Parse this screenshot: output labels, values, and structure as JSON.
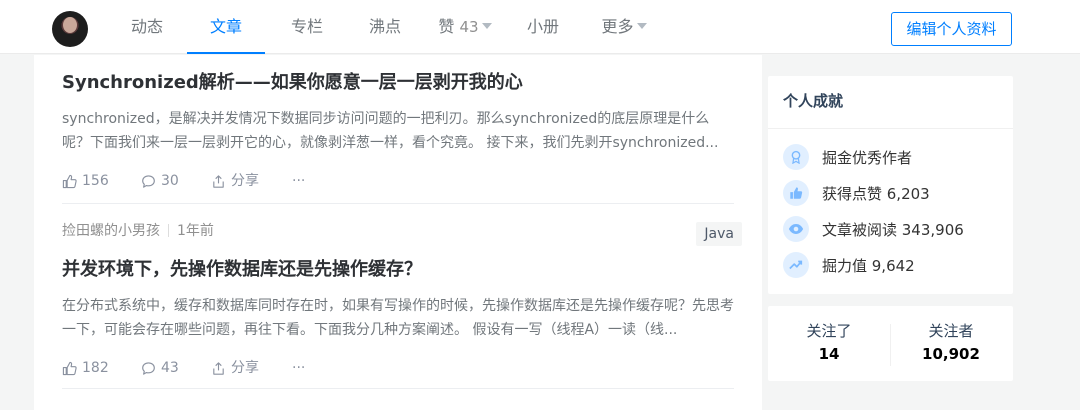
{
  "nav": {
    "tabs": [
      {
        "label": "动态"
      },
      {
        "label": "文章"
      },
      {
        "label": "专栏"
      },
      {
        "label": "沸点"
      },
      {
        "label": "赞",
        "count": "43"
      },
      {
        "label": "小册"
      },
      {
        "label": "更多"
      }
    ],
    "active_tab": "文章",
    "edit_profile": "编辑个人资料"
  },
  "articles": [
    {
      "title": "Synchronized解析——如果你愿意一层一层剥开我的心",
      "abstract": "synchronized，是解决并发情况下数据同步访问问题的一把利刃。那么synchronized的底层原理是什么呢？下面我们来一层一层剥开它的心，就像剥洋葱一样，看个究竟。 接下来，我们先剥开synchronized...",
      "likes": "156",
      "comments": "30",
      "share": "分享",
      "more": "···"
    },
    {
      "author": "捡田螺的小男孩",
      "time": "1年前",
      "tag": "Java",
      "title": "并发环境下，先操作数据库还是先操作缓存？",
      "abstract": "在分布式系统中，缓存和数据库同时存在时，如果有写操作的时候，先操作数据库还是先操作缓存呢？先思考一下，可能会存在哪些问题，再往下看。下面我分几种方案阐述。 假设有一写（线程A）一读（线...",
      "likes": "182",
      "comments": "43",
      "share": "分享",
      "more": "···"
    }
  ],
  "achievements": {
    "title": "个人成就",
    "items": [
      {
        "label": "掘金优秀作者",
        "icon": "medal-icon"
      },
      {
        "label": "获得点赞 6,203",
        "icon": "thumb-up-icon"
      },
      {
        "label": "文章被阅读 343,906",
        "icon": "eye-icon"
      },
      {
        "label": "掘力值 9,642",
        "icon": "trend-icon"
      }
    ]
  },
  "follow": {
    "following_label": "关注了",
    "following_count": "14",
    "followers_label": "关注者",
    "followers_count": "10,902"
  },
  "colors": {
    "accent": "#007fff",
    "icon_bg": "#e1efff",
    "icon_fg": "#7bb9ff"
  }
}
